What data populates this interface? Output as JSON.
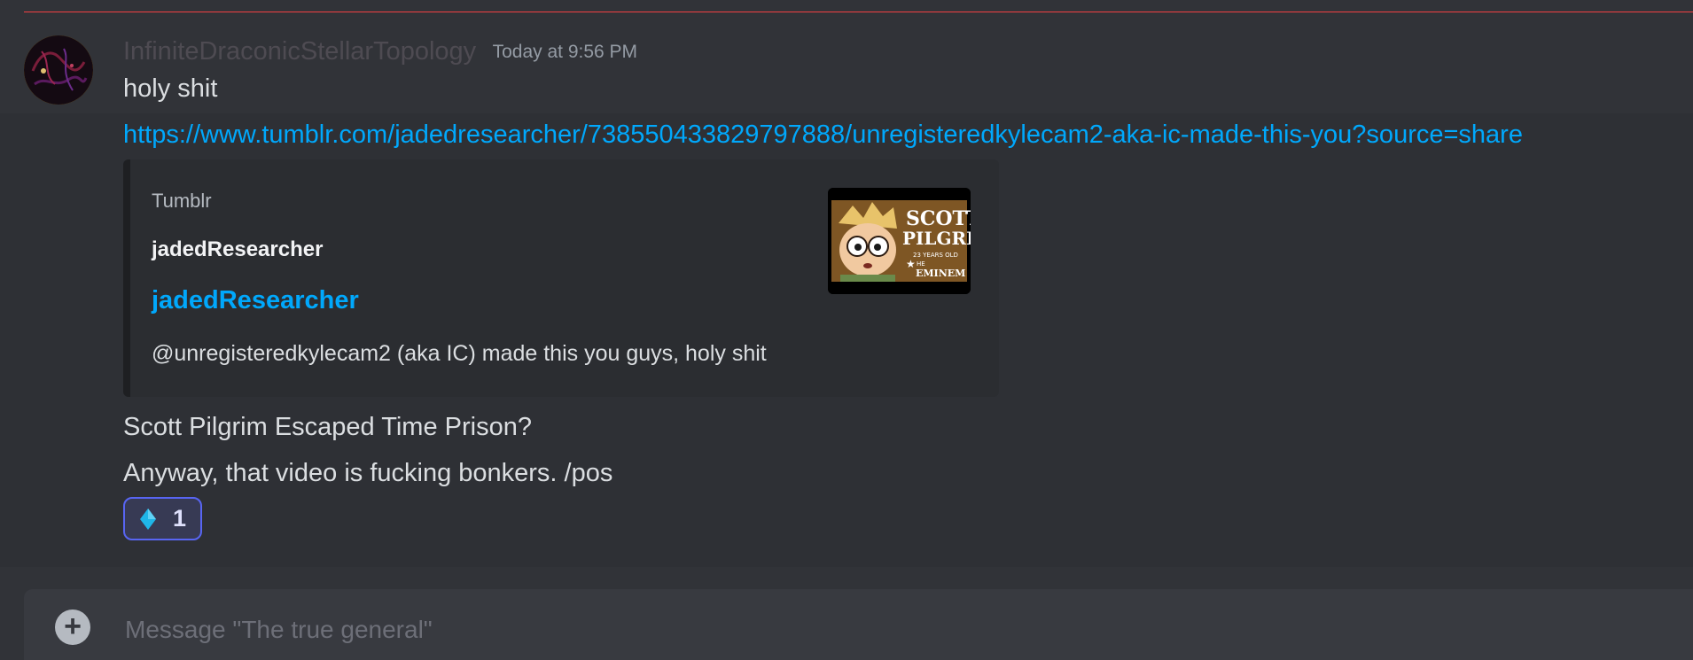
{
  "message": {
    "username": "InfiniteDraconicStellarTopology",
    "timestamp": "Today at 9:56 PM",
    "lines": [
      "holy shit",
      "https://www.tumblr.com/jadedresearcher/738550433829797888/unregisteredkylecam2-aka-ic-made-this-you?source=share",
      "Scott Pilgrim Escaped Time Prison?",
      "Anyway, that video is fucking bonkers. /pos"
    ],
    "embed": {
      "provider": "Tumblr",
      "author": "jadedResearcher",
      "title": "jadedResearcher",
      "description": "@unregisteredkylecam2 (aka IC) made this you guys, holy shit",
      "thumbnail": {
        "icon": "scott-pilgrim-thumbnail",
        "text_top": "SCOTT",
        "text_mid": "PILGRIM",
        "text_small_1": "23 YEARS OLD",
        "text_small_2": "HE",
        "text_small_3": "EMINEM"
      }
    },
    "reactions": [
      {
        "emoji": "blue-diamond-icon",
        "count": "1"
      }
    ]
  },
  "composer": {
    "placeholder": "Message \"The true general\""
  },
  "colors": {
    "background": "#313338",
    "link": "#00a8fc",
    "divider": "#f23f43",
    "reaction_border": "#5865f2",
    "embed_bg": "#2b2d31"
  }
}
